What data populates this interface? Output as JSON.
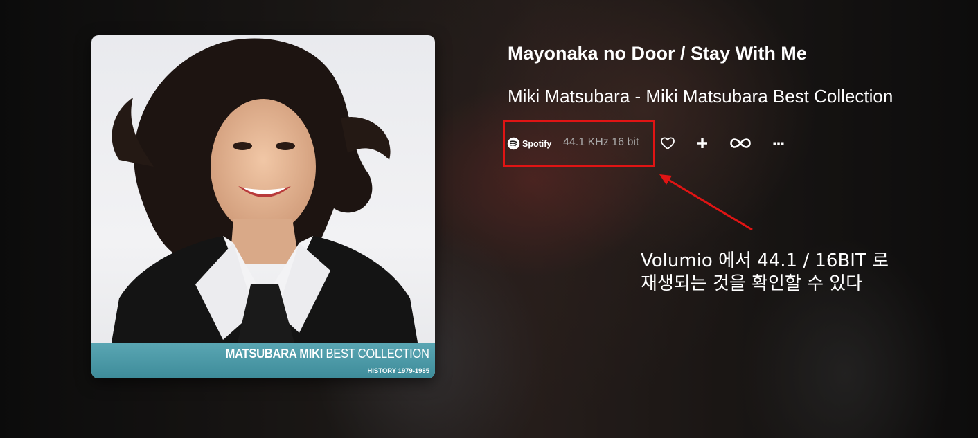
{
  "album": {
    "title_bold": "MATSUBARA MIKI",
    "title_light": "BEST COLLECTION",
    "subtitle": "HISTORY 1979-1985"
  },
  "track": {
    "title": "Mayonaka no Door / Stay With Me",
    "artist_album": "Miki Matsubara - Miki Matsubara Best Collection"
  },
  "player": {
    "service_label": "Spotify",
    "service_icon": "spotify-icon",
    "quality": "44.1 KHz 16 bit",
    "icons": [
      "heart-icon",
      "plus-icon",
      "repeat-icon",
      "more-icon"
    ]
  },
  "annotation": {
    "line1": "Volumio 에서 44.1 / 16BIT 로",
    "line2": "재생되는 것을 확인할 수 있다",
    "highlight_color": "#e01414"
  },
  "colors": {
    "text": "#ffffff",
    "quality_text": "#a9a9a9",
    "album_band": "#4a98a6"
  }
}
